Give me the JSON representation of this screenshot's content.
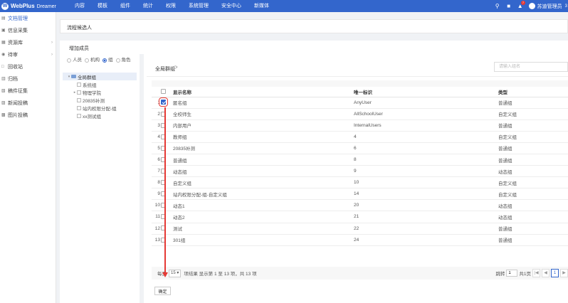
{
  "app": {
    "name": "WebPlus",
    "sub": "Dreamer",
    "logo_glyph": "W"
  },
  "topnav": [
    "内容",
    "模板",
    "组件",
    "统计",
    "权限",
    "系统管理",
    "安全中心",
    "新媒体"
  ],
  "header": {
    "user": "苏迪管理员",
    "notify_count": "7",
    "more": "3"
  },
  "sidebar": [
    {
      "label": "文档管理",
      "icon": "document-icon",
      "arrow": false,
      "active": true
    },
    {
      "label": "信息采集",
      "icon": "collect-icon",
      "arrow": false
    },
    {
      "label": "资源库",
      "icon": "library-icon",
      "arrow": true
    },
    {
      "label": "待审",
      "icon": "review-icon",
      "arrow": true
    },
    {
      "label": "回收站",
      "icon": "trash-icon",
      "arrow": false
    },
    {
      "label": "归档",
      "icon": "archive-icon",
      "arrow": false
    },
    {
      "label": "稿件征集",
      "icon": "manuscript-icon",
      "arrow": false
    },
    {
      "label": "新闻投稿",
      "icon": "news-icon",
      "arrow": false
    },
    {
      "label": "图片投稿",
      "icon": "image-icon",
      "arrow": false
    }
  ],
  "panel": {
    "title": "流程候选人",
    "add_title": "增加成员"
  },
  "tree": {
    "radios": [
      {
        "label": "人员",
        "checked": false
      },
      {
        "label": "机构",
        "checked": false
      },
      {
        "label": "组",
        "checked": true
      },
      {
        "label": "角色",
        "checked": false
      }
    ],
    "nodes": [
      {
        "label": "全局群组",
        "level": 0,
        "expandable": true,
        "root": true
      },
      {
        "label": "系统组",
        "level": 1,
        "expandable": false
      },
      {
        "label": "物理学院",
        "level": 1,
        "expandable": true
      },
      {
        "label": "20835补测",
        "level": 1,
        "expandable": false
      },
      {
        "label": "站内权限分配-组",
        "level": 1,
        "expandable": false
      },
      {
        "label": "xx测试组",
        "level": 1,
        "expandable": false
      }
    ]
  },
  "group": {
    "title": "全局群组",
    "search_placeholder": "请输入组名"
  },
  "table": {
    "headers": {
      "name": "显示名称",
      "key": "唯一标识",
      "type": "类型"
    },
    "rows": [
      {
        "idx": "1",
        "name": "匿名组",
        "key": "AnyUser",
        "type": "普通组",
        "checked": true
      },
      {
        "idx": "2",
        "name": "全校师生",
        "key": "AllSchoolUser",
        "type": "自定义组",
        "checked": false
      },
      {
        "idx": "3",
        "name": "内部用户",
        "key": "InternalUsers",
        "type": "普通组",
        "checked": false
      },
      {
        "idx": "4",
        "name": "教师组",
        "key": "4",
        "type": "自定义组",
        "checked": false
      },
      {
        "idx": "5",
        "name": "20835补测",
        "key": "6",
        "type": "普通组",
        "checked": false
      },
      {
        "idx": "6",
        "name": "普通组",
        "key": "8",
        "type": "普通组",
        "checked": false
      },
      {
        "idx": "7",
        "name": "动态组",
        "key": "9",
        "type": "动态组",
        "checked": false
      },
      {
        "idx": "8",
        "name": "自定义组",
        "key": "10",
        "type": "自定义组",
        "checked": false
      },
      {
        "idx": "9",
        "name": "站内权限分配-组-自定义组",
        "key": "14",
        "type": "自定义组",
        "checked": false
      },
      {
        "idx": "10",
        "name": "动态1",
        "key": "20",
        "type": "动态组",
        "checked": false
      },
      {
        "idx": "11",
        "name": "动态2",
        "key": "21",
        "type": "动态组",
        "checked": false
      },
      {
        "idx": "12",
        "name": "测试",
        "key": "22",
        "type": "普通组",
        "checked": false
      },
      {
        "idx": "13",
        "name": "301组",
        "key": "24",
        "type": "普通组",
        "checked": false
      }
    ]
  },
  "footer": {
    "page_size_label": "每页",
    "page_size": "15",
    "info": "项结果 显示第 1 至 13 项，共 13 项",
    "goto_label": "跳转",
    "goto_value": "1",
    "page_count": "共1页",
    "first": "|◀",
    "prev": "◀",
    "current": "1",
    "next": "▶"
  },
  "confirm_label": "确定",
  "colors": {
    "brand": "#3366cc",
    "annotation": "#e53935"
  }
}
